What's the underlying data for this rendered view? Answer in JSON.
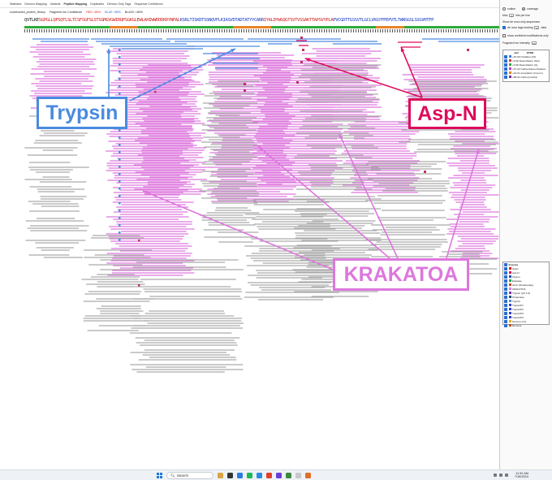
{
  "menu": {
    "tabs": [
      "Statistics",
      "Denovo Mapping",
      "Variants",
      "Peptide Mapping",
      "Duplicates",
      "Denovo Only Tags",
      "Sequence Confidence"
    ],
    "active_tab": "Peptide Mapping"
  },
  "subbar": {
    "protein": "constructed_protein_Heavy",
    "fragment_label": "Fragment Ion Confidence",
    "red_label": "RED >85%",
    "blue_label": "BLUE >80%",
    "black_label": "BLACK <80%"
  },
  "sequence": {
    "segments": [
      {
        "text": "QVTLKE",
        "color": "c3"
      },
      {
        "text": "SGPGLLQPSQTLSLTCSF",
        "color": "c1"
      },
      {
        "text": "SGFSLSTSGMGVGWIRQPSGKGLEWLAHIWWDDDKRYNPAL",
        "color": "c1"
      },
      {
        "text": "KSRLTISKDTSSNQVFLKIASVDTADTATYYCARR",
        "color": "c2"
      },
      {
        "text": "IYALDYWGQGTSVTVSSAKTTAPSVYPLA",
        "color": "c1"
      },
      {
        "text": "PVCGDTTGSSVTLGCLVKGYFPEPVTLTWNSGSLSSGVHTFP",
        "color": "c2"
      }
    ]
  },
  "annotations": {
    "trypsin": "Trypsin",
    "aspn": "Asp-N",
    "krakatoa": "KRAKATOA"
  },
  "panel": {
    "display_options": {
      "outline_label": "outline",
      "coverage_label": "coverage",
      "max_label": "Max",
      "max_value": "5",
      "max_unit": "bits per line",
      "denovo_label": "Show de novo only sequences",
      "denovo_tags_label": "de novo tags sharing",
      "denovo_tags_value": "5",
      "denovo_tags_unit": "data",
      "confident_label": "show confident modifications only",
      "fragment_label": "Fragment Ion Intensity",
      "fragment_value": "10"
    },
    "ptm_header": [
      "ptm",
      "#PSM"
    ],
    "ptms": [
      {
        "label": "+15.99 Oxidation (M)",
        "color": "#3a7fe0"
      },
      {
        "label": "+0.98 Deamidation (NQ)",
        "color": "#d84040"
      },
      {
        "label": "+0.98 Deamidation (Q)",
        "color": "#40a040"
      },
      {
        "label": "+57.02 Carbamidomethylation",
        "color": "#c040c0"
      },
      {
        "label": "+42.01 Acetylation (N-term)",
        "color": "#e08020"
      },
      {
        "label": "+58.01 Carboxymethyl",
        "color": "#7030a0"
      }
    ],
    "enzyme_header": "Enzyme",
    "enzymes": [
      {
        "label": "AspC",
        "color": "#e02020"
      },
      {
        "label": "Asp-N",
        "color": "#dd0c5c"
      },
      {
        "label": "Chymo",
        "color": "#2050c0"
      },
      {
        "label": "Elastase",
        "color": "#20a060"
      },
      {
        "label": "GluC (bicarbonate)",
        "color": "#c05020"
      },
      {
        "label": "KRAKATOA",
        "color": "#dd77dd"
      },
      {
        "label": "Trypsin (pH 1.0)",
        "color": "#8030c0"
      },
      {
        "label": "Proteinase",
        "color": "#205080"
      },
      {
        "label": "Trypsin",
        "color": "#4a8be0"
      },
      {
        "label": "TrypsinP1",
        "color": "#3040d0"
      },
      {
        "label": "TrypsinP2",
        "color": "#3040d0"
      },
      {
        "label": "TrypsinP3",
        "color": "#3040d0"
      },
      {
        "label": "TrypsinP4",
        "color": "#3040d0"
      },
      {
        "label": "Denovo only",
        "color": "#e0b020"
      },
      {
        "label": "Remove",
        "color": "#c05020"
      }
    ]
  },
  "taskbar": {
    "search_placeholder": "Search",
    "time": "11:32 AM",
    "date": "7/18/2024"
  },
  "colors": {
    "trypsin": "#4a8be0",
    "krakatoa": "#dd77dd",
    "aspn": "#dd0c5c",
    "grey_peptide": "#aaaaaa"
  }
}
